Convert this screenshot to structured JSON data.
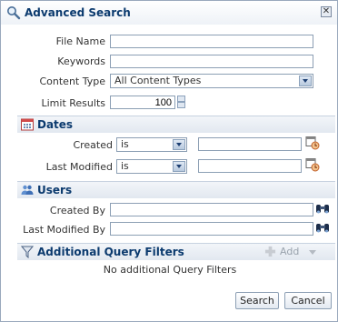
{
  "dialog": {
    "title": "Advanced Search",
    "close_glyph": "✕"
  },
  "fields": {
    "file_name": {
      "label": "File Name",
      "value": ""
    },
    "keywords": {
      "label": "Keywords",
      "value": ""
    },
    "content_type": {
      "label": "Content Type",
      "value": "All Content Types"
    },
    "limit_results": {
      "label": "Limit Results",
      "value": "100"
    }
  },
  "dates": {
    "title": "Dates",
    "created": {
      "label": "Created",
      "operator": "is",
      "value": ""
    },
    "last_modified": {
      "label": "Last Modified",
      "operator": "is",
      "value": ""
    }
  },
  "users": {
    "title": "Users",
    "created_by": {
      "label": "Created By",
      "value": ""
    },
    "last_modified_by": {
      "label": "Last Modified By",
      "value": ""
    }
  },
  "query_filters": {
    "title": "Additional Query Filters",
    "add_label": "Add",
    "empty_text": "No additional Query Filters"
  },
  "buttons": {
    "search": "Search",
    "cancel": "Cancel"
  },
  "icons": {
    "title": "search-icon",
    "dates": "calendar-grid-icon",
    "users": "users-icon",
    "filters": "funnel-icon",
    "date_picker": "calendar-clock-icon",
    "user_lookup": "binoculars-icon",
    "add": "plus-icon"
  },
  "colors": {
    "accent": "#0b3a6e",
    "border": "#8c9fb4"
  }
}
